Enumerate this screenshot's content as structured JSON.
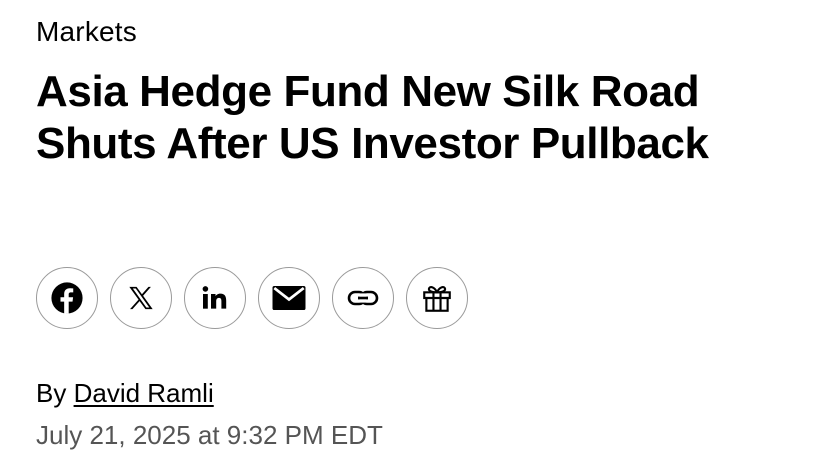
{
  "article": {
    "section": "Markets",
    "headline": "Asia Hedge Fund New Silk Road Shuts After US Investor Pullback",
    "byline_prefix": "By",
    "author": "David Ramli",
    "timestamp": "July 21, 2025 at 9:32 PM EDT"
  },
  "share": {
    "buttons": [
      {
        "name": "facebook",
        "icon": "facebook-icon"
      },
      {
        "name": "x",
        "icon": "x-icon"
      },
      {
        "name": "linkedin",
        "icon": "linkedin-icon"
      },
      {
        "name": "email",
        "icon": "envelope-icon"
      },
      {
        "name": "copy-link",
        "icon": "link-icon"
      },
      {
        "name": "gift",
        "icon": "gift-icon"
      }
    ]
  },
  "colors": {
    "text": "#000000",
    "timestamp": "#555555",
    "button_border": "#9a9a9a",
    "background": "#ffffff"
  }
}
